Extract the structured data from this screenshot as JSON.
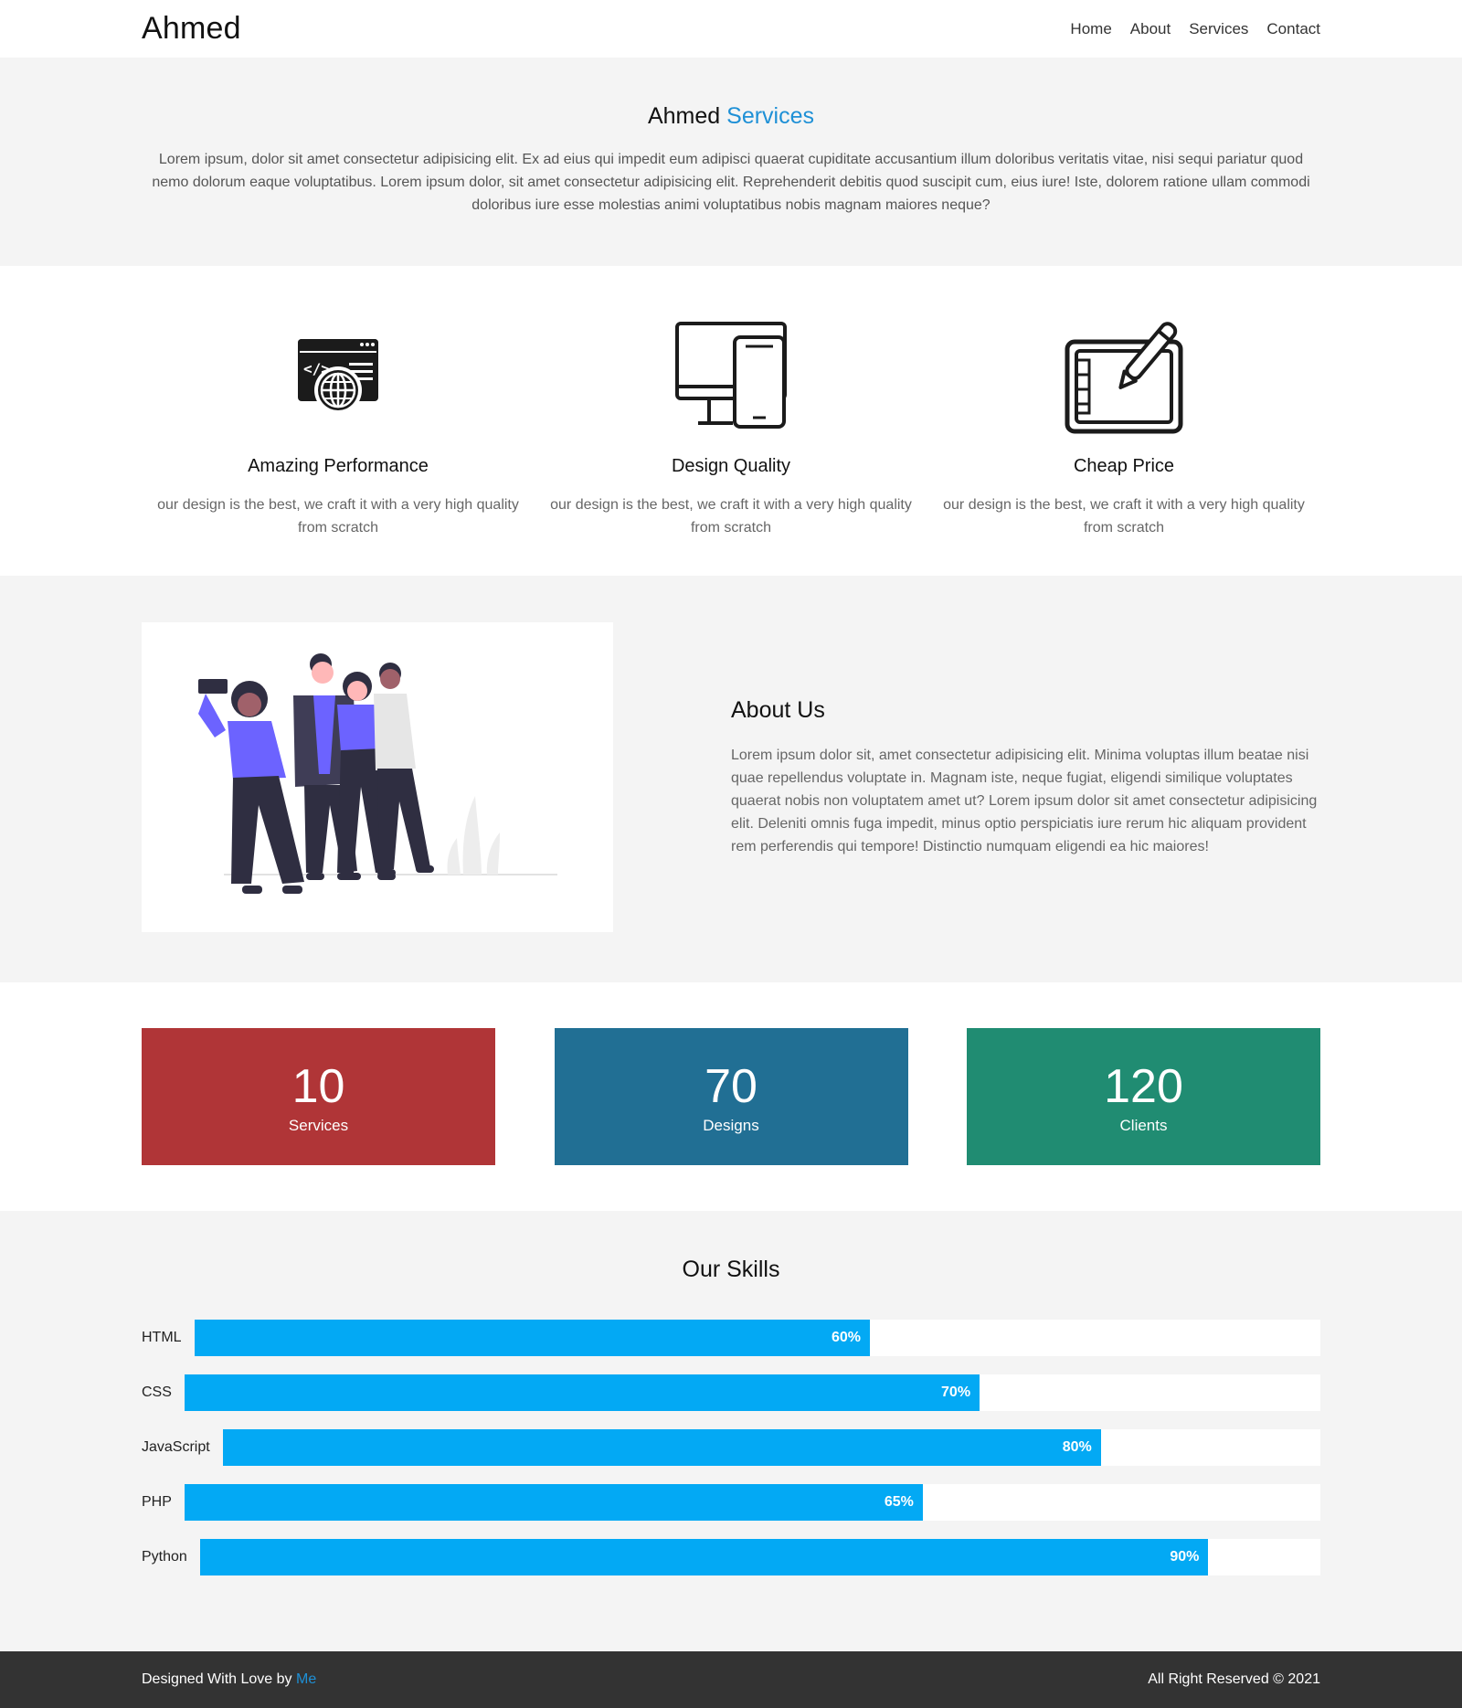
{
  "nav": {
    "brand": "Ahmed",
    "links": [
      "Home",
      "About",
      "Services",
      "Contact"
    ]
  },
  "hero": {
    "title_main": "Ahmed",
    "title_accent": "Services",
    "text": "Lorem ipsum, dolor sit amet consectetur adipisicing elit. Ex ad eius qui impedit eum adipisci quaerat cupiditate accusantium illum doloribus veritatis vitae, nisi sequi pariatur quod nemo dolorum eaque voluptatibus. Lorem ipsum dolor, sit amet consectetur adipisicing elit. Reprehenderit debitis quod suscipit cum, eius iure! Iste, dolorem ratione ullam commodi doloribus iure esse molestias animi voluptatibus nobis magnam maiores neque?"
  },
  "features": [
    {
      "icon": "web-development-icon",
      "title": "Amazing Performance",
      "text": "our design is the best, we craft it with a very high quality from scratch"
    },
    {
      "icon": "responsive-devices-icon",
      "title": "Design Quality",
      "text": "our design is the best, we craft it with a very high quality from scratch"
    },
    {
      "icon": "graphic-tablet-pen-icon",
      "title": "Cheap Price",
      "text": "our design is the best, we craft it with a very high quality from scratch"
    }
  ],
  "about": {
    "title": "About Us",
    "text": "Lorem ipsum dolor sit, amet consectetur adipisicing elit. Minima voluptas illum beatae nisi quae repellendus voluptate in. Magnam iste, neque fugiat, eligendi similique voluptates quaerat nobis non voluptatem amet ut? Lorem ipsum dolor sit amet consectetur adipisicing elit. Deleniti omnis fuga impedit, minus optio perspiciatis iure rerum hic aliquam provident rem perferendis qui tempore! Distinctio numquam eligendi ea hic maiores!"
  },
  "stats": [
    {
      "number": "10",
      "label": "Services",
      "color": "#b03537"
    },
    {
      "number": "70",
      "label": "Designs",
      "color": "#216f94"
    },
    {
      "number": "120",
      "label": "Clients",
      "color": "#208c72"
    }
  ],
  "skills": {
    "title": "Our Skills",
    "items": [
      {
        "name": "HTML",
        "percent": 60,
        "label": "60%"
      },
      {
        "name": "CSS",
        "percent": 70,
        "label": "70%"
      },
      {
        "name": "JavaScript",
        "percent": 80,
        "label": "80%"
      },
      {
        "name": "PHP",
        "percent": 65,
        "label": "65%"
      },
      {
        "name": "Python",
        "percent": 90,
        "label": "90%"
      }
    ]
  },
  "footer": {
    "left_text": "Designed With Love by ",
    "left_link": "Me",
    "right_text": "All Right Reserved © 2021"
  },
  "colors": {
    "accent": "#1e90d6",
    "skill_bar": "#03a9f4",
    "illustration_purple": "#6c63ff"
  }
}
